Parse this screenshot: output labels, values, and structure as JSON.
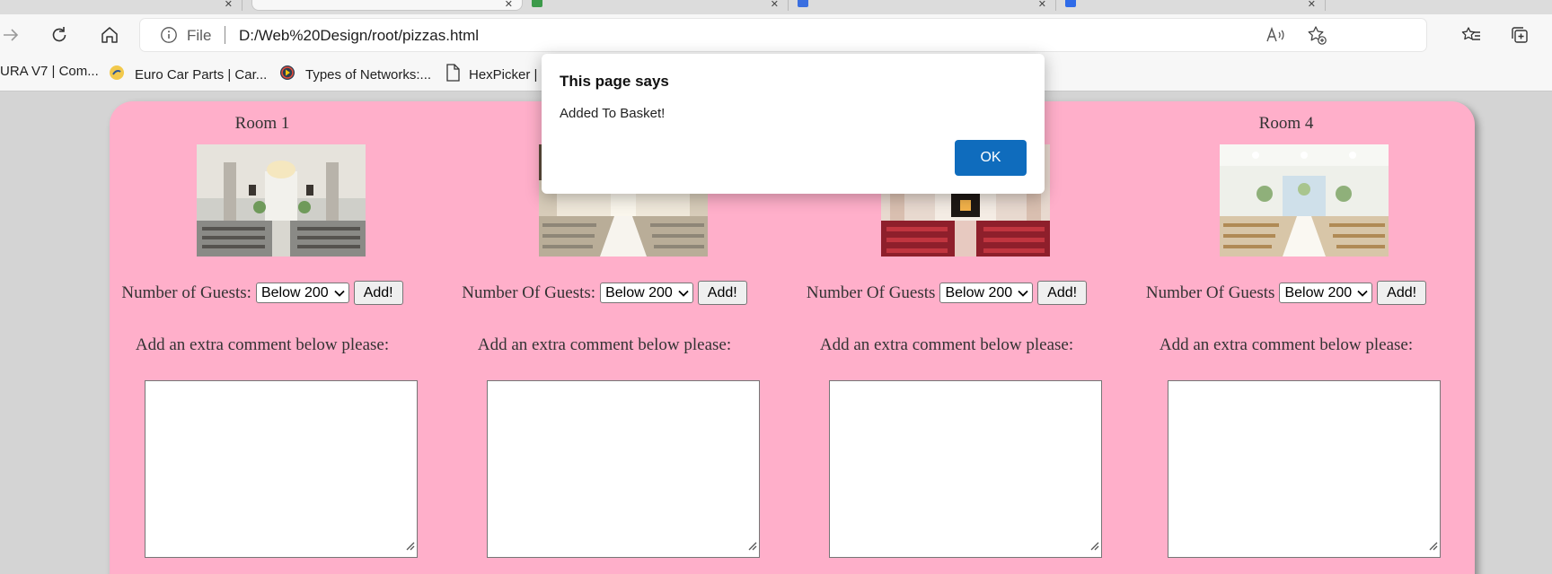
{
  "browser": {
    "address": {
      "scheme_label": "File",
      "url": "D:/Web%20Design/root/pizzas.html"
    },
    "bookmarks": [
      {
        "label": "URA V7 | Com..."
      },
      {
        "label": "Euro Car Parts | Car..."
      },
      {
        "label": "Types of Networks:..."
      },
      {
        "label": "HexPicker |"
      }
    ],
    "icons": {
      "forward": "forward-arrow-icon",
      "refresh": "refresh-icon",
      "home": "home-icon",
      "info": "info-icon",
      "read_aloud": "read-aloud-icon",
      "add_favorite": "add-favorite-icon",
      "favorites": "favorites-icon",
      "collections": "collections-icon"
    }
  },
  "page": {
    "accent_color": "#ffafca",
    "rooms": [
      {
        "title": "Room 1",
        "guests_label": "Number of Guests:",
        "guests_value": "Below 200",
        "add_label": "Add!",
        "comment_label": "Add an extra comment below please:"
      },
      {
        "title": "",
        "guests_label": "Number Of Guests:",
        "guests_value": "Below 200",
        "add_label": "Add!",
        "comment_label": "Add an extra comment below please:"
      },
      {
        "title": "",
        "guests_label": "Number Of Guests",
        "guests_value": "Below 200",
        "add_label": "Add!",
        "comment_label": "Add an extra comment below please:"
      },
      {
        "title": "Room 4",
        "guests_label": "Number Of Guests",
        "guests_value": "Below 200",
        "add_label": "Add!",
        "comment_label": "Add an extra comment below please:"
      }
    ]
  },
  "dialog": {
    "title": "This page says",
    "message": "Added To Basket!",
    "ok_label": "OK",
    "ok_color": "#0f6cbd"
  }
}
